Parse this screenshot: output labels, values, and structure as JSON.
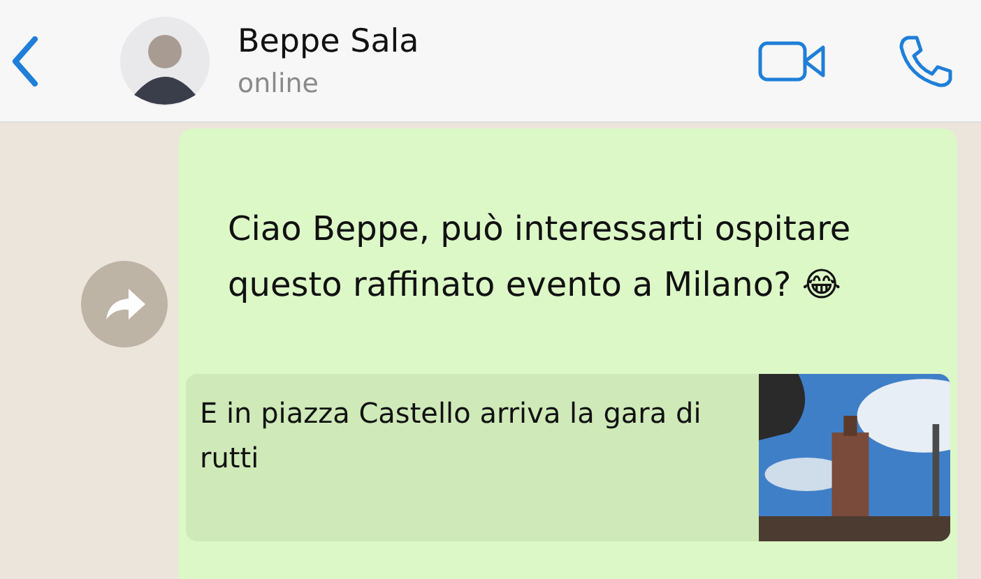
{
  "header": {
    "name": "Beppe Sala",
    "status": "online"
  },
  "messages": [
    {
      "kind": "outgoing",
      "text": "Ciao Beppe, può interessarti ospitare questo raffinato evento a Milano? 😂",
      "preview": {
        "title": "E in piazza Castello arriva la gara di rutti"
      }
    }
  ]
}
